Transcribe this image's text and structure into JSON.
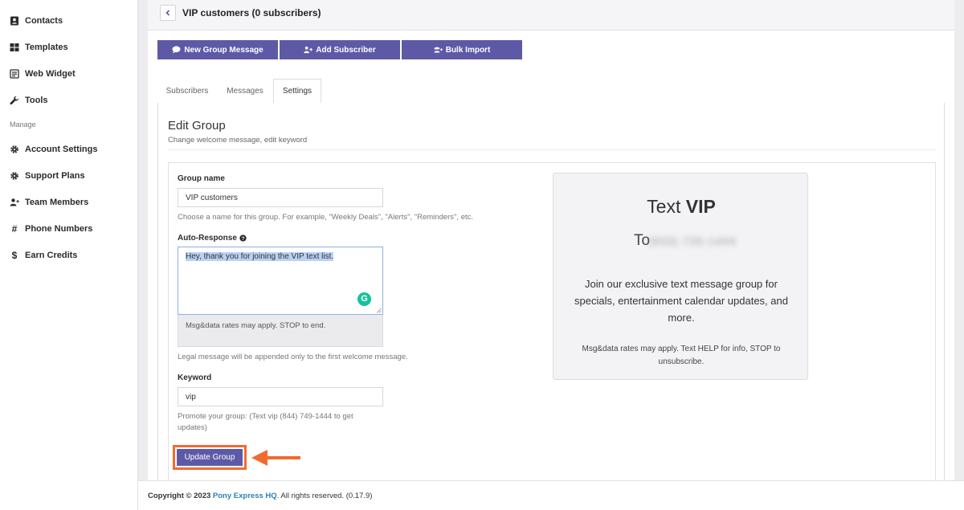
{
  "sidebar": {
    "items": [
      {
        "label": "Contacts",
        "icon": "contacts-icon"
      },
      {
        "label": "Templates",
        "icon": "grid-icon"
      },
      {
        "label": "Web Widget",
        "icon": "widget-icon"
      },
      {
        "label": "Tools",
        "icon": "wrench-icon"
      }
    ],
    "section_label": "Manage",
    "manage_items": [
      {
        "label": "Account Settings",
        "icon": "gear-icon"
      },
      {
        "label": "Support Plans",
        "icon": "gear-icon"
      },
      {
        "label": "Team Members",
        "icon": "add-user-icon"
      },
      {
        "label": "Phone Numbers",
        "icon": "hash-icon"
      },
      {
        "label": "Earn Credits",
        "icon": "dollar-icon"
      }
    ]
  },
  "header": {
    "title": "VIP customers (0 subscribers)"
  },
  "actions": {
    "new_group_message": "New Group Message",
    "add_subscriber": "Add Subscriber",
    "bulk_import": "Bulk Import"
  },
  "tabs": {
    "subscribers": "Subscribers",
    "messages": "Messages",
    "settings": "Settings"
  },
  "edit_group": {
    "title": "Edit Group",
    "subtitle": "Change welcome message, edit keyword",
    "group_name_label": "Group name",
    "group_name_value": "VIP customers",
    "group_name_help": "Choose a name for this group. For example, \"Weekly Deals\", \"Alerts\", \"Reminders\", etc.",
    "auto_response_label": "Auto-Response",
    "auto_response_value": "Hey, thank you for joining the VIP text list.",
    "legal_text": "Msg&data rates may apply. STOP to end.",
    "legal_help": "Legal message will be appended only to the first welcome message.",
    "keyword_label": "Keyword",
    "keyword_value": "vip",
    "keyword_help": "Promote your group: (Text vip (844) 749-1444 to get updates)",
    "update_button": "Update Group"
  },
  "preview": {
    "text_word": "Text",
    "keyword": "VIP",
    "to_word": "To",
    "phone_blurred": "(833) 735-1444",
    "description": "Join our exclusive text message group for specials, entertainment calendar updates, and more.",
    "legal": "Msg&data rates may apply. Text HELP for info, STOP to unsubscribe."
  },
  "footer": {
    "copyright": "Copyright © 2023",
    "brand": "Pony Express HQ",
    "rights": ". All rights reserved. (0.17.9)"
  },
  "colors": {
    "accent": "#5e59a6",
    "highlight": "#f26b2e",
    "link": "#2d7fb8"
  }
}
